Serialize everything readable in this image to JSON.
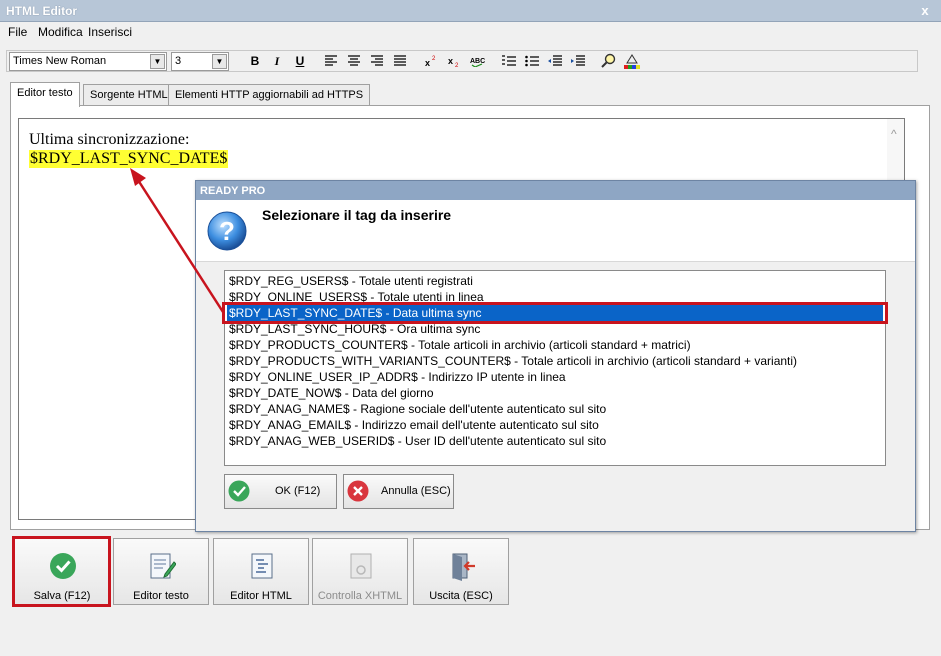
{
  "window": {
    "title": "HTML Editor",
    "close_glyph": "x"
  },
  "menu": {
    "items": [
      "File",
      "Modifica",
      "Inserisci"
    ]
  },
  "toolbar": {
    "font_family": "Times New Roman",
    "font_size": "3",
    "bold": "B",
    "italic": "I",
    "underline": "U",
    "icons": [
      "align-left-icon",
      "align-center-icon",
      "align-right-icon",
      "align-justify-icon",
      "superscript-icon",
      "subscript-icon",
      "spellcheck-icon",
      "ordered-list-icon",
      "unordered-list-icon",
      "outdent-icon",
      "indent-icon",
      "find-icon",
      "color-icon"
    ]
  },
  "tabs": [
    {
      "label": "Editor testo",
      "active": true
    },
    {
      "label": "Sorgente HTML",
      "active": false
    },
    {
      "label": "Elementi HTTP aggiornabili ad HTTPS",
      "active": false
    }
  ],
  "editor": {
    "line1": "Ultima sincronizzazione:",
    "line2": "$RDY_LAST_SYNC_DATE$",
    "highlight_color": "#ffff33"
  },
  "dialog": {
    "title": "READY PRO",
    "heading": "Selezionare il tag da inserire",
    "items": [
      "$RDY_REG_USERS$ - Totale utenti registrati",
      "$RDY_ONLINE_USERS$ - Totale utenti in linea",
      "$RDY_LAST_SYNC_DATE$ - Data ultima sync",
      "$RDY_LAST_SYNC_HOUR$ - Ora ultima sync",
      "$RDY_PRODUCTS_COUNTER$ - Totale articoli in archivio (articoli standard + matrici)",
      "$RDY_PRODUCTS_WITH_VARIANTS_COUNTER$ - Totale articoli in archivio (articoli standard + varianti)",
      "$RDY_ONLINE_USER_IP_ADDR$ - Indirizzo IP utente in linea",
      "$RDY_DATE_NOW$ - Data del giorno",
      "$RDY_ANAG_NAME$ - Ragione sociale dell'utente autenticato sul sito",
      "$RDY_ANAG_EMAIL$ - Indirizzo email dell'utente autenticato sul sito",
      "$RDY_ANAG_WEB_USERID$ - User ID dell'utente autenticato sul sito"
    ],
    "selected_index": 2,
    "ok_label": "OK (F12)",
    "cancel_label": "Annulla (ESC)",
    "selection_color": "#0a64c8"
  },
  "actions": [
    {
      "name": "save-button",
      "label": "Salva (F12)",
      "icon": "check-icon",
      "enabled": true
    },
    {
      "name": "text-editor-button",
      "label": "Editor testo",
      "icon": "edit-document-icon",
      "enabled": true
    },
    {
      "name": "html-editor-button",
      "label": "Editor HTML",
      "icon": "html-document-icon",
      "enabled": true
    },
    {
      "name": "check-xhtml-button",
      "label": "Controlla XHTML",
      "icon": "xhtml-check-icon",
      "enabled": false
    },
    {
      "name": "exit-button",
      "label": "Uscita (ESC)",
      "icon": "exit-door-icon",
      "enabled": true
    }
  ],
  "annotation_color": "#c8141e"
}
